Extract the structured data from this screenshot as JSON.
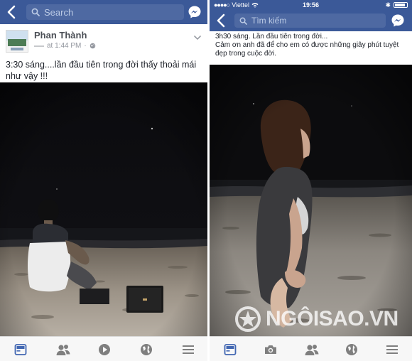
{
  "left": {
    "search": {
      "placeholder": "Search"
    },
    "post": {
      "author": "Phan Thành",
      "time": "at 1:44 PM",
      "caption": "3:30 sáng....lần đầu tiên trong đời thấy thoải mái như vậy !!!"
    }
  },
  "right": {
    "status": {
      "carrier": "Viettel",
      "time": "19:56"
    },
    "search": {
      "placeholder": "Tìm kiếm"
    },
    "caption_lines": [
      "3h30 sáng. Lần đầu tiên trong đời...",
      "Cảm ơn anh đã để cho em có được những giây phút tuyệt",
      "đẹp trong cuộc đời."
    ]
  },
  "watermark": {
    "text": "NGÔISAO.VN"
  },
  "icons": {
    "back": "chevron-left-icon",
    "search": "search-icon",
    "messenger": "messenger-icon",
    "tabs": [
      "news-feed-icon",
      "friends-icon",
      "video-icon",
      "globe-icon",
      "menu-icon"
    ],
    "tabs_right": [
      "news-feed-icon",
      "camera-icon",
      "friends-icon",
      "globe-icon",
      "menu-icon"
    ]
  },
  "colors": {
    "header": "#3b5998",
    "search_bg": "#4e69a2",
    "active_tab": "#4267b2",
    "inactive_tab": "#7f7f7f"
  }
}
